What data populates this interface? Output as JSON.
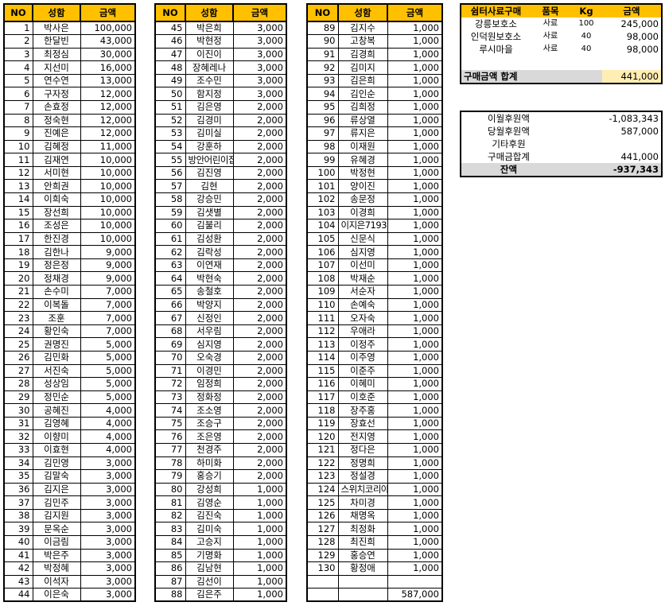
{
  "headers": {
    "no": "NO",
    "name": "성함",
    "amount": "금액"
  },
  "col1": [
    [
      "1",
      "박사은",
      "100,000"
    ],
    [
      "2",
      "한달빈",
      "43,000"
    ],
    [
      "3",
      "최정심",
      "30,000"
    ],
    [
      "4",
      "지선미",
      "16,000"
    ],
    [
      "5",
      "연수연",
      "13,000"
    ],
    [
      "6",
      "구자정",
      "12,000"
    ],
    [
      "7",
      "손효정",
      "12,000"
    ],
    [
      "8",
      "정숙현",
      "12,000"
    ],
    [
      "9",
      "진예은",
      "12,000"
    ],
    [
      "10",
      "김혜정",
      "11,000"
    ],
    [
      "11",
      "김재연",
      "10,000"
    ],
    [
      "12",
      "서미현",
      "10,000"
    ],
    [
      "13",
      "안희권",
      "10,000"
    ],
    [
      "14",
      "이희숙",
      "10,000"
    ],
    [
      "15",
      "장선희",
      "10,000"
    ],
    [
      "16",
      "조성은",
      "10,000"
    ],
    [
      "17",
      "한진경",
      "10,000"
    ],
    [
      "18",
      "김한나",
      "9,000"
    ],
    [
      "19",
      "정은정",
      "9,000"
    ],
    [
      "20",
      "정채경",
      "9,000"
    ],
    [
      "21",
      "손수미",
      "7,000"
    ],
    [
      "22",
      "이복돌",
      "7,000"
    ],
    [
      "23",
      "조훈",
      "7,000"
    ],
    [
      "24",
      "황인숙",
      "7,000"
    ],
    [
      "25",
      "권명진",
      "5,000"
    ],
    [
      "26",
      "김민화",
      "5,000"
    ],
    [
      "27",
      "서진숙",
      "5,000"
    ],
    [
      "28",
      "성상임",
      "5,000"
    ],
    [
      "29",
      "정민순",
      "5,000"
    ],
    [
      "30",
      "공혜진",
      "4,000"
    ],
    [
      "31",
      "김영혜",
      "4,000"
    ],
    [
      "32",
      "이향미",
      "4,000"
    ],
    [
      "33",
      "이효현",
      "4,000"
    ],
    [
      "34",
      "김민영",
      "3,000"
    ],
    [
      "35",
      "김말숙",
      "3,000"
    ],
    [
      "36",
      "김지은",
      "3,000"
    ],
    [
      "37",
      "김민주",
      "3,000"
    ],
    [
      "38",
      "김지원",
      "3,000"
    ],
    [
      "39",
      "문옥순",
      "3,000"
    ],
    [
      "40",
      "이금림",
      "3,000"
    ],
    [
      "41",
      "박은주",
      "3,000"
    ],
    [
      "42",
      "박정혜",
      "3,000"
    ],
    [
      "43",
      "이석자",
      "3,000"
    ],
    [
      "44",
      "이은숙",
      "3,000"
    ]
  ],
  "col2": [
    [
      "45",
      "박은희",
      "3,000"
    ],
    [
      "46",
      "박현정",
      "3,000"
    ],
    [
      "47",
      "이진이",
      "3,000"
    ],
    [
      "48",
      "장혜레나",
      "3,000"
    ],
    [
      "49",
      "조수민",
      "3,000"
    ],
    [
      "50",
      "함지정",
      "3,000"
    ],
    [
      "51",
      "김은영",
      "2,000"
    ],
    [
      "52",
      "김경미",
      "2,000"
    ],
    [
      "53",
      "김미실",
      "2,000"
    ],
    [
      "54",
      "강훈하",
      "2,000"
    ],
    [
      "55",
      "방안어린이집",
      "2,000"
    ],
    [
      "56",
      "김진영",
      "2,000"
    ],
    [
      "57",
      "김현",
      "2,000"
    ],
    [
      "58",
      "강승민",
      "2,000"
    ],
    [
      "59",
      "김샛별",
      "2,000"
    ],
    [
      "60",
      "김불리",
      "2,000"
    ],
    [
      "61",
      "김성환",
      "2,000"
    ],
    [
      "62",
      "김락성",
      "2,000"
    ],
    [
      "63",
      "이연재",
      "2,000"
    ],
    [
      "64",
      "박현숙",
      "2,000"
    ],
    [
      "65",
      "송철호",
      "2,000"
    ],
    [
      "66",
      "박양지",
      "2,000"
    ],
    [
      "67",
      "신정인",
      "2,000"
    ],
    [
      "68",
      "서우림",
      "2,000"
    ],
    [
      "69",
      "심지영",
      "2,000"
    ],
    [
      "70",
      "오숙경",
      "2,000"
    ],
    [
      "71",
      "이경민",
      "2,000"
    ],
    [
      "72",
      "임정희",
      "2,000"
    ],
    [
      "73",
      "정화정",
      "2,000"
    ],
    [
      "74",
      "조소영",
      "2,000"
    ],
    [
      "75",
      "조승구",
      "2,000"
    ],
    [
      "76",
      "조은영",
      "2,000"
    ],
    [
      "77",
      "천경주",
      "2,000"
    ],
    [
      "78",
      "하미화",
      "2,000"
    ],
    [
      "79",
      "홍승기",
      "2,000"
    ],
    [
      "80",
      "강성희",
      "1,000"
    ],
    [
      "81",
      "김영순",
      "1,000"
    ],
    [
      "82",
      "김진숙",
      "1,000"
    ],
    [
      "83",
      "김미숙",
      "1,000"
    ],
    [
      "84",
      "고승지",
      "1,000"
    ],
    [
      "85",
      "기명화",
      "1,000"
    ],
    [
      "86",
      "김남현",
      "1,000"
    ],
    [
      "87",
      "김선이",
      "1,000"
    ],
    [
      "88",
      "김은주",
      "1,000"
    ]
  ],
  "col3": [
    [
      "89",
      "김지수",
      "1,000"
    ],
    [
      "90",
      "고창복",
      "1,000"
    ],
    [
      "91",
      "김경희",
      "1,000"
    ],
    [
      "92",
      "김미지",
      "1,000"
    ],
    [
      "93",
      "김은희",
      "1,000"
    ],
    [
      "94",
      "김인순",
      "1,000"
    ],
    [
      "95",
      "김희정",
      "1,000"
    ],
    [
      "96",
      "류상열",
      "1,000"
    ],
    [
      "97",
      "류지은",
      "1,000"
    ],
    [
      "98",
      "이재원",
      "1,000"
    ],
    [
      "99",
      "유혜경",
      "1,000"
    ],
    [
      "100",
      "박정현",
      "1,000"
    ],
    [
      "101",
      "양이진",
      "1,000"
    ],
    [
      "102",
      "송문정",
      "1,000"
    ],
    [
      "103",
      "이경희",
      "1,000"
    ],
    [
      "104",
      "이지은7193",
      "1,000"
    ],
    [
      "105",
      "신문식",
      "1,000"
    ],
    [
      "106",
      "심지영",
      "1,000"
    ],
    [
      "107",
      "이선미",
      "1,000"
    ],
    [
      "108",
      "박재순",
      "1,000"
    ],
    [
      "109",
      "서순자",
      "1,000"
    ],
    [
      "110",
      "손예숙",
      "1,000"
    ],
    [
      "111",
      "오자숙",
      "1,000"
    ],
    [
      "112",
      "우애라",
      "1,000"
    ],
    [
      "113",
      "이정주",
      "1,000"
    ],
    [
      "114",
      "이주영",
      "1,000"
    ],
    [
      "115",
      "이준주",
      "1,000"
    ],
    [
      "116",
      "이혜미",
      "1,000"
    ],
    [
      "117",
      "이호준",
      "1,000"
    ],
    [
      "118",
      "장주홍",
      "1,000"
    ],
    [
      "119",
      "장효선",
      "1,000"
    ],
    [
      "120",
      "전지영",
      "1,000"
    ],
    [
      "121",
      "정다은",
      "1,000"
    ],
    [
      "122",
      "정명희",
      "1,000"
    ],
    [
      "123",
      "정설경",
      "1,000"
    ],
    [
      "124",
      "스위치코리아",
      "1,000"
    ],
    [
      "125",
      "차미경",
      "1,000"
    ],
    [
      "126",
      "채명옥",
      "1,000"
    ],
    [
      "127",
      "최정화",
      "1,000"
    ],
    [
      "128",
      "최진희",
      "1,000"
    ],
    [
      "129",
      "홍승연",
      "1,000"
    ],
    [
      "130",
      "황정애",
      "1,000"
    ],
    [
      "",
      "",
      ""
    ],
    [
      "",
      "",
      "587,000"
    ]
  ],
  "purchase": {
    "headers": [
      "쉼터사료구매",
      "품목",
      "Kg",
      "금액"
    ],
    "rows": [
      [
        "강릉보호소",
        "사료",
        "100",
        "245,000"
      ],
      [
        "인덕원보호소",
        "사료",
        "40",
        "98,000"
      ],
      [
        "루시마을",
        "사료",
        "40",
        "98,000"
      ]
    ],
    "total_label": "구매금액 합계",
    "total_value": "441,000"
  },
  "balance": {
    "rows": [
      [
        "이월후원액",
        "-1,083,343"
      ],
      [
        "당월후원액",
        "587,000"
      ],
      [
        "기타후원",
        ""
      ],
      [
        "구매금합계",
        "441,000"
      ]
    ],
    "final_label": "잔액",
    "final_value": "-937,343"
  },
  "colors": {
    "header": "#ffc000",
    "total_bg": "#ffeeb3",
    "gray": "#d9d9d9"
  }
}
